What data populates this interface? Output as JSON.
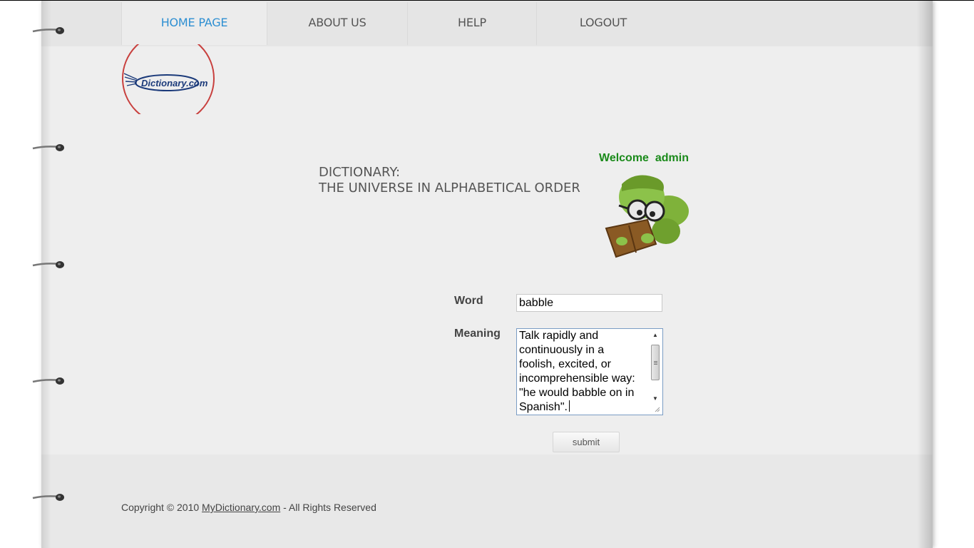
{
  "nav": {
    "items": [
      {
        "label": "HOME PAGE"
      },
      {
        "label": "ABOUT US"
      },
      {
        "label": "HELP"
      },
      {
        "label": "LOGOUT"
      }
    ]
  },
  "logo": {
    "text": "Dictionary.com"
  },
  "tagline": {
    "line1": "DICTIONARY:",
    "line2": "THE UNIVERSE IN ALPHABETICAL ORDER"
  },
  "welcome": {
    "greeting": "Welcome",
    "user": "admin"
  },
  "form": {
    "word_label": "Word",
    "word_value": "babble",
    "meaning_label": "Meaning",
    "meaning_value": "Talk rapidly and\ncontinuously in a\nfoolish, excited, or\nincomprehensible way:\n\"he would babble on in\nSpanish\".",
    "submit_label": "submit"
  },
  "footer": {
    "prefix": "Copyright © 2010 ",
    "link": "MyDictionary.com",
    "suffix": " - All Rights Reserved"
  },
  "colors": {
    "nav_active": "#2e8fd2",
    "welcome": "#1a8a1a",
    "logo_ring": "#c8403e",
    "logo_text": "#1b3a7a"
  },
  "icons": [
    "binder-ring-icon",
    "dictionary-logo",
    "bookworm-mascot-image",
    "scrollbar-up-arrow-icon",
    "scrollbar-down-arrow-icon",
    "resize-grip-icon"
  ]
}
